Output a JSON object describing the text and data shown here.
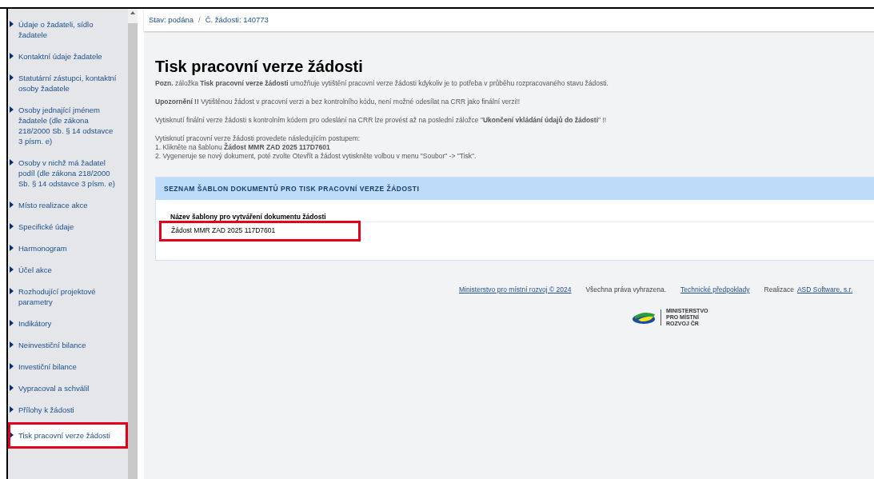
{
  "sidebar": {
    "items": [
      {
        "label": "Údaje o žadateli, sídlo žadatele",
        "selected": false
      },
      {
        "label": "Kontaktní údaje žadatele",
        "selected": false
      },
      {
        "label": "Statutární zástupci, kontaktní osoby žadatele",
        "selected": false
      },
      {
        "label": "Osoby jednající jménem žadatele (dle zákona 218/2000 Sb. § 14 odstavce 3 písm. e)",
        "selected": false
      },
      {
        "label": "Osoby v nichž má žadatel podíl (dle zákona 218/2000 Sb. § 14 odstavce 3 písm. e)",
        "selected": false
      },
      {
        "label": "Místo realizace akce",
        "selected": false
      },
      {
        "label": "Specifické údaje",
        "selected": false
      },
      {
        "label": "Harmonogram",
        "selected": false
      },
      {
        "label": "Účel akce",
        "selected": false
      },
      {
        "label": "Rozhodující projektové parametry",
        "selected": false
      },
      {
        "label": "Indikátory",
        "selected": false
      },
      {
        "label": "Neinvestiční bilance",
        "selected": false
      },
      {
        "label": "Investiční bilance",
        "selected": false
      },
      {
        "label": "Vypracoval a schválil",
        "selected": false
      },
      {
        "label": "Přílohy k žádosti",
        "selected": false
      },
      {
        "label": "Tisk pracovní verze žádosti",
        "selected": true
      }
    ]
  },
  "breadcrumb": [
    "Stav: podána",
    "/",
    "Č. žádosti: 140773"
  ],
  "title": "Tisk pracovní verze žádosti",
  "paragraphs": [
    [
      "**Pozn.** záložka **Tisk pracovní verze žádosti** umožňuje vytištění pracovní verze žádosti kdykoliv je to potřeba v průběhu rozpracovaného stavu žádosti."
    ],
    [
      "**Upozornění !!** Vytištěnou žádost v pracovní verzi a bez kontrolního kódu, není možné odesílat na CRR jako finální verzi!!"
    ],
    [
      "Vytisknutí finální verze žádosti s kontrolním kódem pro odeslání na CRR lze provést až na poslední záložce \"**Ukončení vkládání údajů do žádosti**\" !!"
    ],
    [
      "Vytisknutí pracovní verze žádosti provedete následujícím postupem:",
      "1. Klikněte na šablonu **Žádost MMR ZAD 2025 117D7601**",
      "2. Vygeneruje se nový dokument, poté zvolte Otevřít a žádost vytiskněte volbou v menu \"Soubor\" -> \"Tisk\"."
    ]
  ],
  "templates": {
    "heading": "SEZNAM ŠABLON DOKUMENTŮ PRO TISK PRACOVNÍ VERZE ŽÁDOSTI",
    "column": "Název šablony pro vytváření dokumentu žádosti",
    "rows": [
      {
        "name": "Žádost MMR ZAD 2025 117D7601",
        "highlighted": true
      }
    ]
  },
  "footer": [
    {
      "kind": "link",
      "text": "Ministerstvo pro místní rozvoj © 2024"
    },
    {
      "kind": "text",
      "text": "Všechna práva vyhrazena."
    },
    {
      "kind": "link",
      "text": "Technické předpoklady"
    },
    {
      "kind": "text",
      "text": "Realizace"
    },
    {
      "kind": "link",
      "text": "ASD Software, s.r."
    }
  ],
  "logo": {
    "lines": [
      "MINISTERSTVO",
      "PRO MÍSTNÍ",
      "ROZVOJ ČR"
    ]
  }
}
